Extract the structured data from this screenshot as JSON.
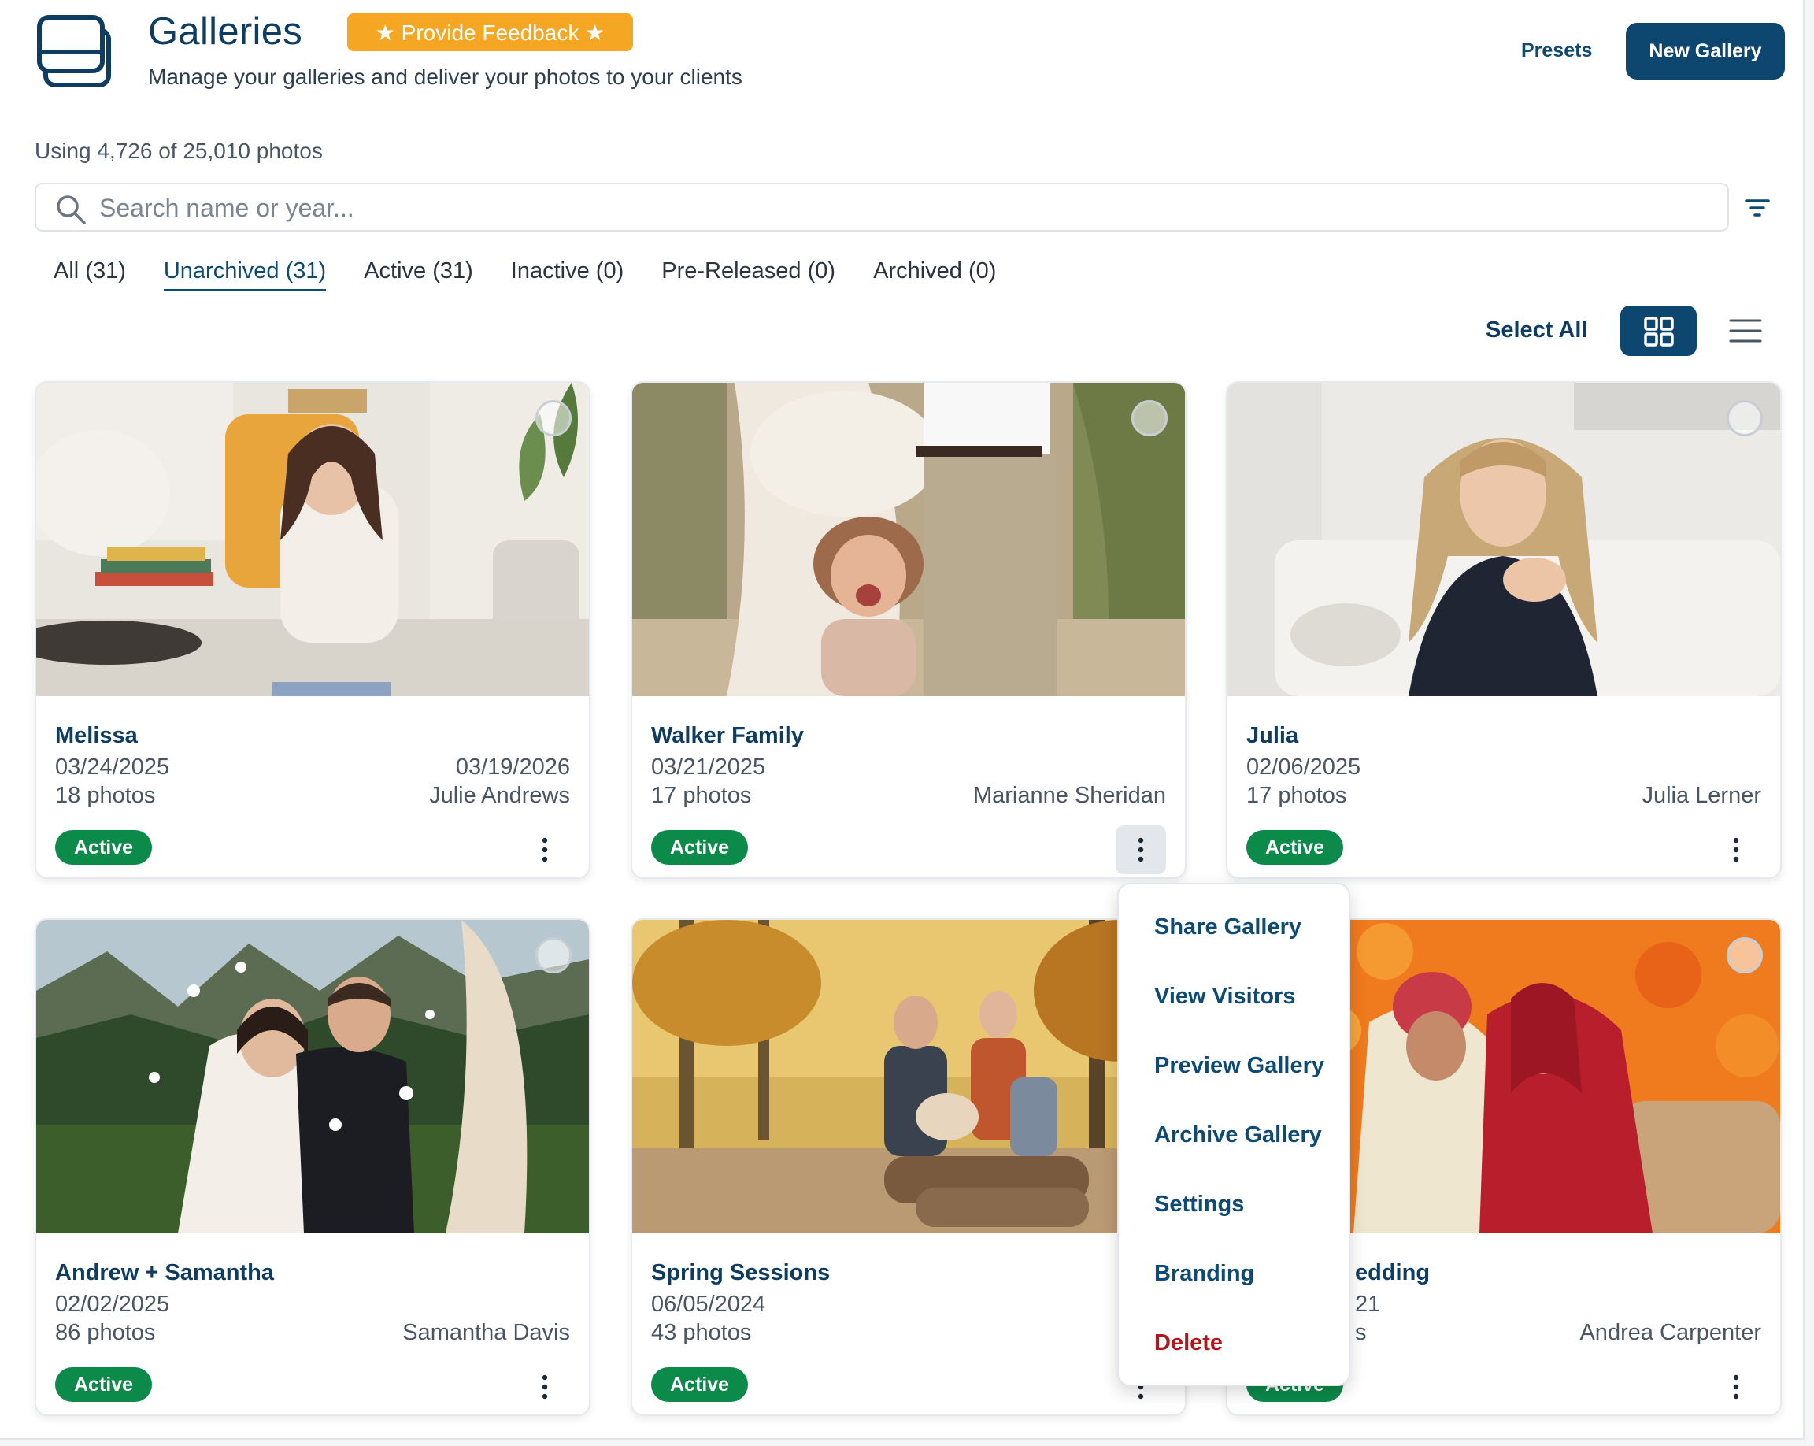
{
  "header": {
    "title": "Galleries",
    "feedback_label": "★ Provide Feedback ★",
    "subtitle": "Manage your galleries and deliver your photos to your clients",
    "presets_label": "Presets",
    "new_gallery_label": "New Gallery"
  },
  "usage_text": "Using 4,726 of 25,010 photos",
  "search": {
    "placeholder": "Search name or year...",
    "value": ""
  },
  "tabs": [
    {
      "label": "All (31)",
      "active": false
    },
    {
      "label": "Unarchived (31)",
      "active": true
    },
    {
      "label": "Active (31)",
      "active": false
    },
    {
      "label": "Inactive (0)",
      "active": false
    },
    {
      "label": "Pre-Released (0)",
      "active": false
    },
    {
      "label": "Archived (0)",
      "active": false
    }
  ],
  "toolbar": {
    "select_all_label": "Select All",
    "view_mode": "grid"
  },
  "galleries": [
    {
      "name": "Melissa",
      "date": "03/24/2025",
      "expiry": "03/19/2026",
      "photos": "18 photos",
      "client": "Julie Andrews",
      "status": "Active"
    },
    {
      "name": "Walker Family",
      "date": "03/21/2025",
      "expiry": "",
      "photos": "17 photos",
      "client": "Marianne Sheridan",
      "status": "Active"
    },
    {
      "name": "Julia",
      "date": "02/06/2025",
      "expiry": "",
      "photos": "17 photos",
      "client": "Julia Lerner",
      "status": "Active"
    },
    {
      "name": "Andrew + Samantha",
      "date": "02/02/2025",
      "expiry": "",
      "photos": "86 photos",
      "client": "Samantha Davis",
      "status": "Active"
    },
    {
      "name": "Spring Sessions",
      "date": "06/05/2024",
      "expiry": "",
      "photos": "43 photos",
      "client": "",
      "status": "Active"
    },
    {
      "name": "edding",
      "date": "21",
      "expiry": "",
      "photos": "s",
      "client": "Andrea Carpenter",
      "status": "Active"
    }
  ],
  "context_menu": {
    "items": [
      "Share Gallery",
      "View Visitors",
      "Preview Gallery",
      "Archive Gallery",
      "Settings",
      "Branding"
    ],
    "danger_item": "Delete"
  },
  "colors": {
    "brand": "#0d4770",
    "feedback": "#f5a623",
    "active_badge": "#0b8a4a",
    "danger": "#b3161a"
  }
}
